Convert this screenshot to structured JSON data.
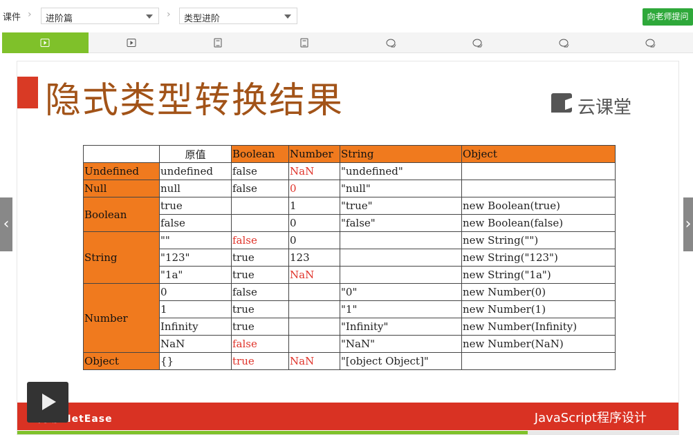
{
  "breadcrumb": {
    "root": "课件",
    "course_select": "进阶篇",
    "chapter_select": "类型进阶"
  },
  "ask_button": "向老师提问",
  "tabs": [
    {
      "icon": "play-icon",
      "active": true
    },
    {
      "icon": "play-icon",
      "active": false
    },
    {
      "icon": "document-icon",
      "active": false
    },
    {
      "icon": "document-icon",
      "active": false
    },
    {
      "icon": "chat-icon",
      "active": false
    },
    {
      "icon": "chat-icon",
      "active": false
    },
    {
      "icon": "chat-icon",
      "active": false
    },
    {
      "icon": "chat-icon",
      "active": false
    }
  ],
  "slide": {
    "title": "隐式类型转换结果",
    "logo_text": "云课堂",
    "footer_left": "网易 NetEase",
    "footer_right": "JavaScript程序设计",
    "table": {
      "headers": [
        "",
        "原值",
        "Boolean",
        "Number",
        "String",
        "Object"
      ],
      "rows": [
        [
          "Undefined",
          "undefined",
          "false",
          "NaN",
          "\"undefined\"",
          ""
        ],
        [
          "Null",
          "null",
          "false",
          "0",
          "\"null\"",
          ""
        ],
        [
          "Boolean",
          "true",
          "",
          "1",
          "\"true\"",
          "new Boolean(true)"
        ],
        [
          "",
          "false",
          "",
          "0",
          "\"false\"",
          "new Boolean(false)"
        ],
        [
          "String",
          "\"\"",
          "false",
          "0",
          "",
          "new String(\"\")"
        ],
        [
          "",
          "\"123\"",
          "true",
          "123",
          "",
          "new String(\"123\")"
        ],
        [
          "",
          "\"1a\"",
          "true",
          "NaN",
          "",
          "new String(\"1a\")"
        ],
        [
          "Number",
          "0",
          "false",
          "",
          "\"0\"",
          "new Number(0)"
        ],
        [
          "",
          "1",
          "true",
          "",
          "\"1\"",
          "new Number(1)"
        ],
        [
          "",
          "Infinity",
          "true",
          "",
          "\"Infinity\"",
          "new Number(Infinity)"
        ],
        [
          "",
          "NaN",
          "false",
          "",
          "\"NaN\"",
          "new Number(NaN)"
        ],
        [
          "Object",
          "{}",
          "true",
          "NaN",
          "\"[object Object]\"",
          ""
        ]
      ]
    }
  },
  "player": {
    "progress": 0.77
  },
  "colors": {
    "accent_green": "#7fc12a",
    "ask_green": "#2ea83a",
    "table_header_orange": "#f07a1e",
    "band_red": "#d93223",
    "title_brown": "#a25318",
    "highlight_red": "#e0332a"
  }
}
